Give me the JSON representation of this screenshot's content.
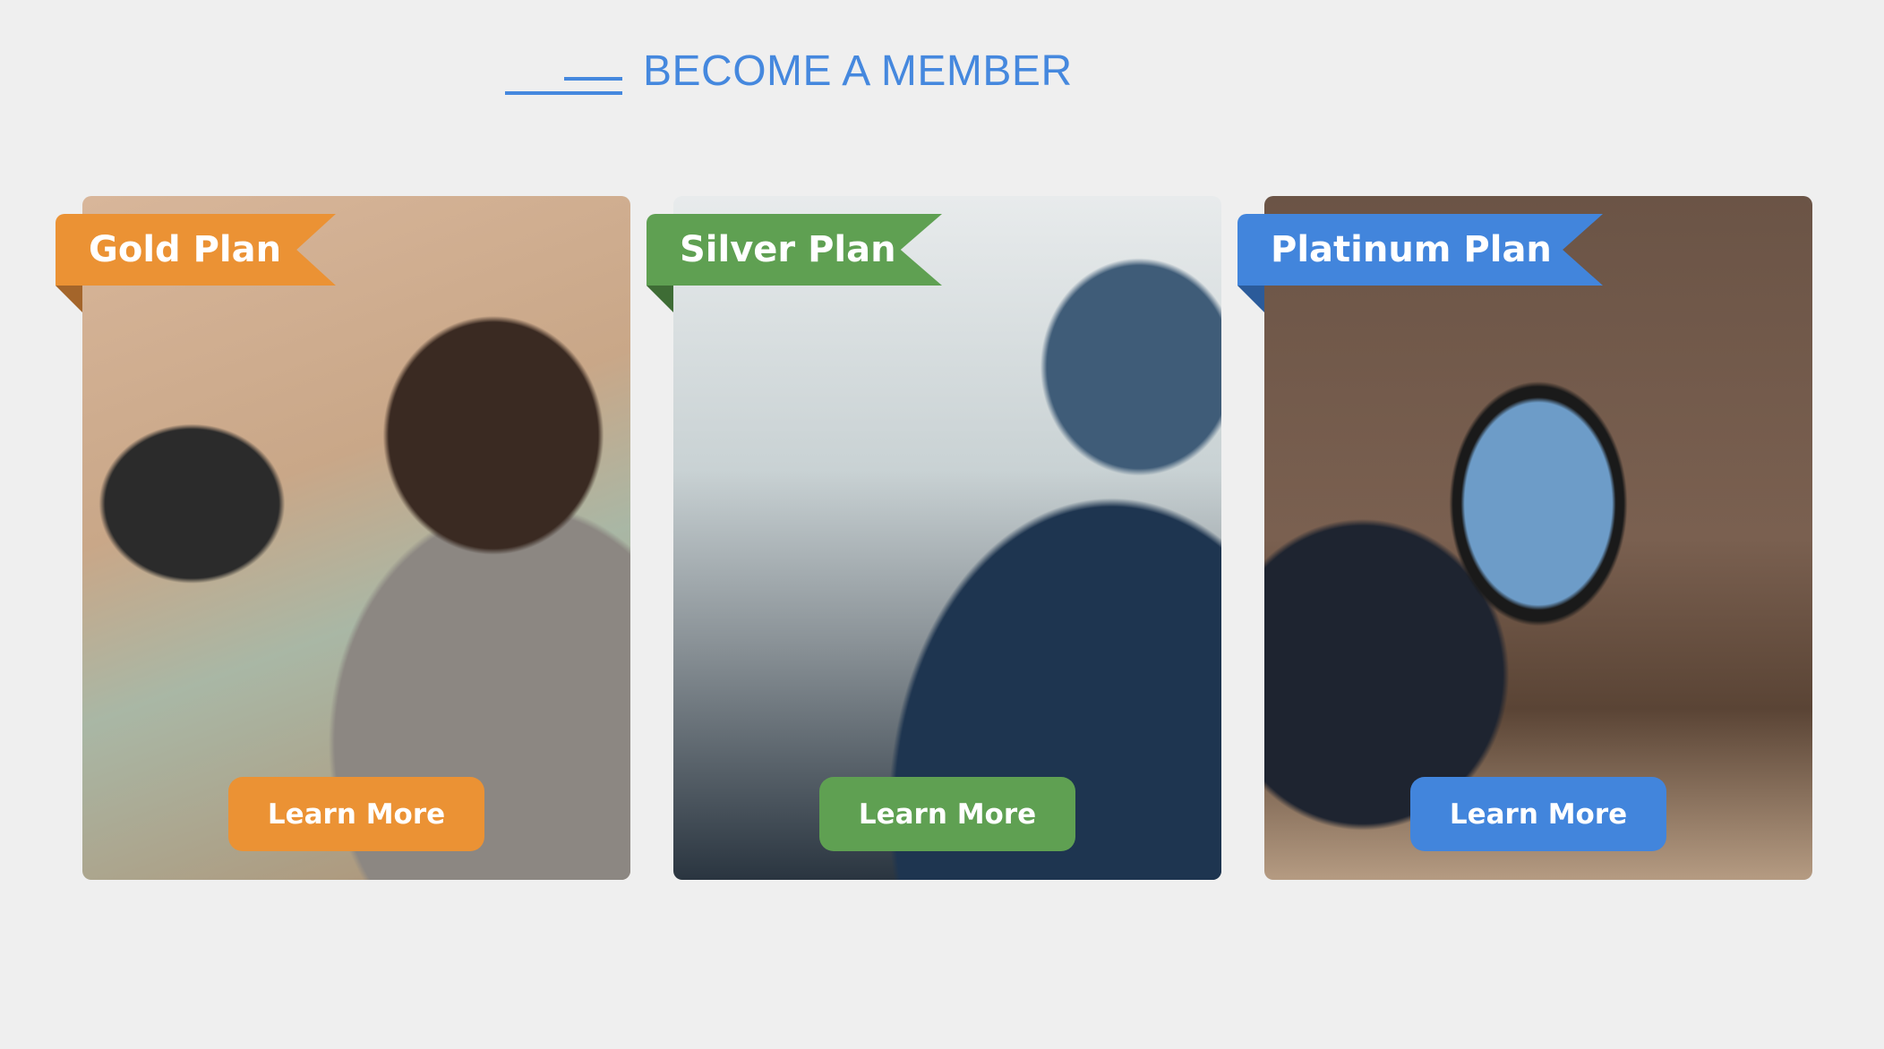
{
  "header": {
    "title": "BECOME A MEMBER",
    "accent_color": "#4588de"
  },
  "plans": [
    {
      "name": "Gold Plan",
      "button": "Learn More",
      "color": "#eb9234",
      "fold_color": "#a4652a"
    },
    {
      "name": "Silver Plan",
      "button": "Learn More",
      "color": "#5fa052",
      "fold_color": "#3e6c35"
    },
    {
      "name": "Platinum Plan",
      "button": "Learn More",
      "color": "#4285dc",
      "fold_color": "#2b5b9a"
    }
  ]
}
